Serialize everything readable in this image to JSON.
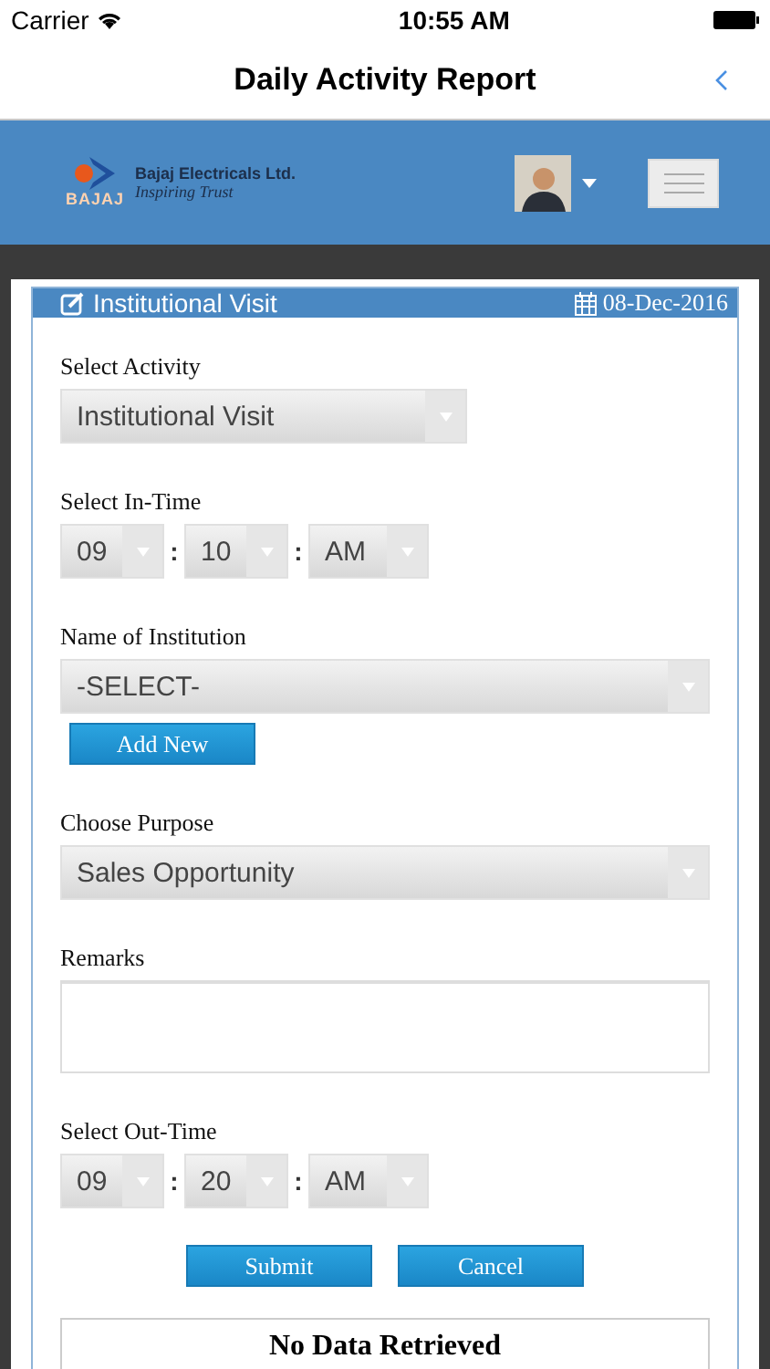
{
  "status_bar": {
    "carrier": "Carrier",
    "time": "10:55 AM"
  },
  "nav": {
    "title": "Daily Activity Report"
  },
  "header": {
    "logo_word": "BAJAJ",
    "company": "Bajaj Electricals Ltd.",
    "tagline": "Inspiring Trust"
  },
  "card": {
    "title": "Institutional Visit",
    "date": "08-Dec-2016"
  },
  "fields": [
    {
      "kind": "select",
      "label": "Select Activity",
      "value": "Institutional Visit",
      "wide": false
    },
    {
      "kind": "time",
      "label": "Select In-Time",
      "hour": "09",
      "minute": "10",
      "period": "AM",
      "separator": ":"
    },
    {
      "kind": "select",
      "label": "Name of Institution",
      "value": "-SELECT-",
      "wide": true,
      "action": "Add New"
    },
    {
      "kind": "select",
      "label": "Choose Purpose",
      "value": "Sales Opportunity",
      "wide": true
    },
    {
      "kind": "textarea",
      "label": "Remarks"
    },
    {
      "kind": "time",
      "label": "Select Out-Time",
      "hour": "09",
      "minute": "20",
      "period": "AM",
      "separator": ":"
    }
  ],
  "buttons": [
    "Submit",
    "Cancel"
  ],
  "result": "No Data Retrieved"
}
